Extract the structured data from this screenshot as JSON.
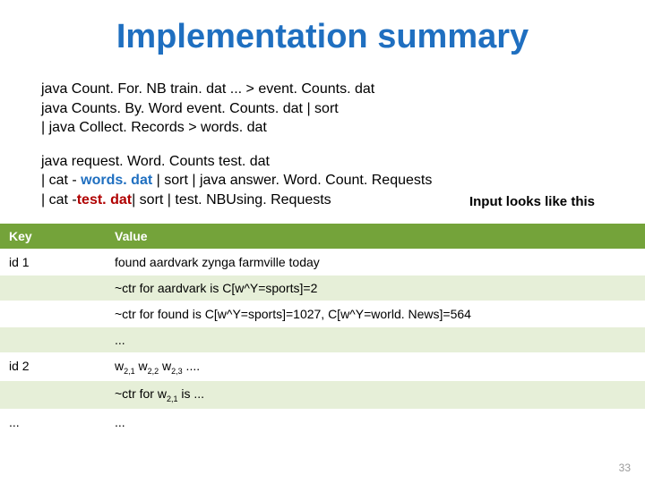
{
  "title": "Implementation summary",
  "code1": {
    "l1": "java Count. For. NB train. dat ... > event. Counts. dat",
    "l2": "java Counts. By. Word event. Counts. dat | sort",
    "l3": "| java Collect. Records   > words. dat"
  },
  "code2": {
    "l1": "java request. Word. Counts  test. dat",
    "l2_a": "| cat - ",
    "l2_b": "words. dat",
    "l2_c": " | sort | java answer. Word. Count. Requests",
    "l3_a": "| cat -",
    "l3_b": "test. dat",
    "l3_c": "| sort | test. NBUsing. Requests"
  },
  "note": "Input looks like this",
  "table": {
    "headers": [
      "Key",
      "Value"
    ],
    "rows": [
      {
        "key": "id 1",
        "value": "found aardvark zynga farmville today"
      },
      {
        "key": "",
        "value": "~ctr for aardvark is C[w^Y=sports]=2"
      },
      {
        "key": "",
        "value": "~ctr for found is C[w^Y=sports]=1027, C[w^Y=world. News]=564"
      },
      {
        "key": "",
        "value": "..."
      },
      {
        "key": "id 2",
        "value_html": "w<span class='sub'>2,1</span> w<span class='sub'>2,2</span> w<span class='sub'>2,3</span> ...."
      },
      {
        "key": "",
        "value_html": "~ctr for w<span class='sub'>2,1</span> is ..."
      },
      {
        "key": "...",
        "value": "..."
      }
    ]
  },
  "pagenum": "33"
}
